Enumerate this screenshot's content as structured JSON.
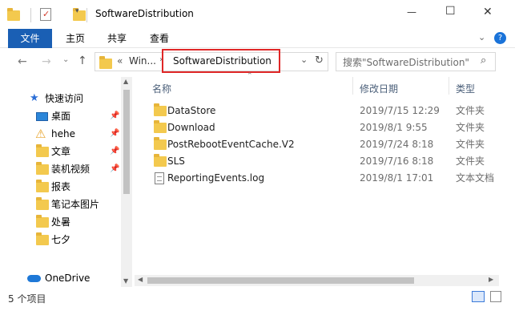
{
  "window": {
    "title": "SoftwareDistribution"
  },
  "title_controls": {
    "minimize": "—",
    "maximize": "☐",
    "close": "✕"
  },
  "ribbon": {
    "tabs": [
      {
        "label": "文件"
      },
      {
        "label": "主页"
      },
      {
        "label": "共享"
      },
      {
        "label": "查看"
      }
    ],
    "accent": "#1a5fb4"
  },
  "address": {
    "path_prefix": "«",
    "crumb": "Win...",
    "current": "SoftwareDistribution"
  },
  "search": {
    "placeholder": "搜索\"SoftwareDistribution\""
  },
  "columns": {
    "name": "名称",
    "date": "修改日期",
    "type": "类型"
  },
  "sidebar": {
    "quick_access": "快速访问",
    "items": [
      {
        "label": "桌面",
        "icon": "desktop-icon",
        "pinned": true
      },
      {
        "label": "hehe",
        "icon": "warning-icon",
        "pinned": true
      },
      {
        "label": "文章",
        "icon": "folder-icon",
        "pinned": true
      },
      {
        "label": "装机视频",
        "icon": "folder-icon",
        "pinned": true
      },
      {
        "label": "报表",
        "icon": "folder-icon",
        "pinned": false
      },
      {
        "label": "笔记本图片",
        "icon": "folder-icon",
        "pinned": false
      },
      {
        "label": "处暑",
        "icon": "folder-icon",
        "pinned": false
      },
      {
        "label": "七夕",
        "icon": "folder-icon",
        "pinned": false
      }
    ],
    "onedrive": "OneDrive"
  },
  "files": [
    {
      "name": "DataStore",
      "date": "2019/7/15 12:29",
      "type": "文件夹",
      "icon": "folder-icon"
    },
    {
      "name": "Download",
      "date": "2019/8/1 9:55",
      "type": "文件夹",
      "icon": "folder-icon"
    },
    {
      "name": "PostRebootEventCache.V2",
      "date": "2019/7/24 8:18",
      "type": "文件夹",
      "icon": "folder-icon"
    },
    {
      "name": "SLS",
      "date": "2019/7/16 8:18",
      "type": "文件夹",
      "icon": "folder-icon"
    },
    {
      "name": "ReportingEvents.log",
      "date": "2019/8/1 17:01",
      "type": "文本文档",
      "icon": "text-file-icon"
    }
  ],
  "status": {
    "count": "5 个项目"
  }
}
